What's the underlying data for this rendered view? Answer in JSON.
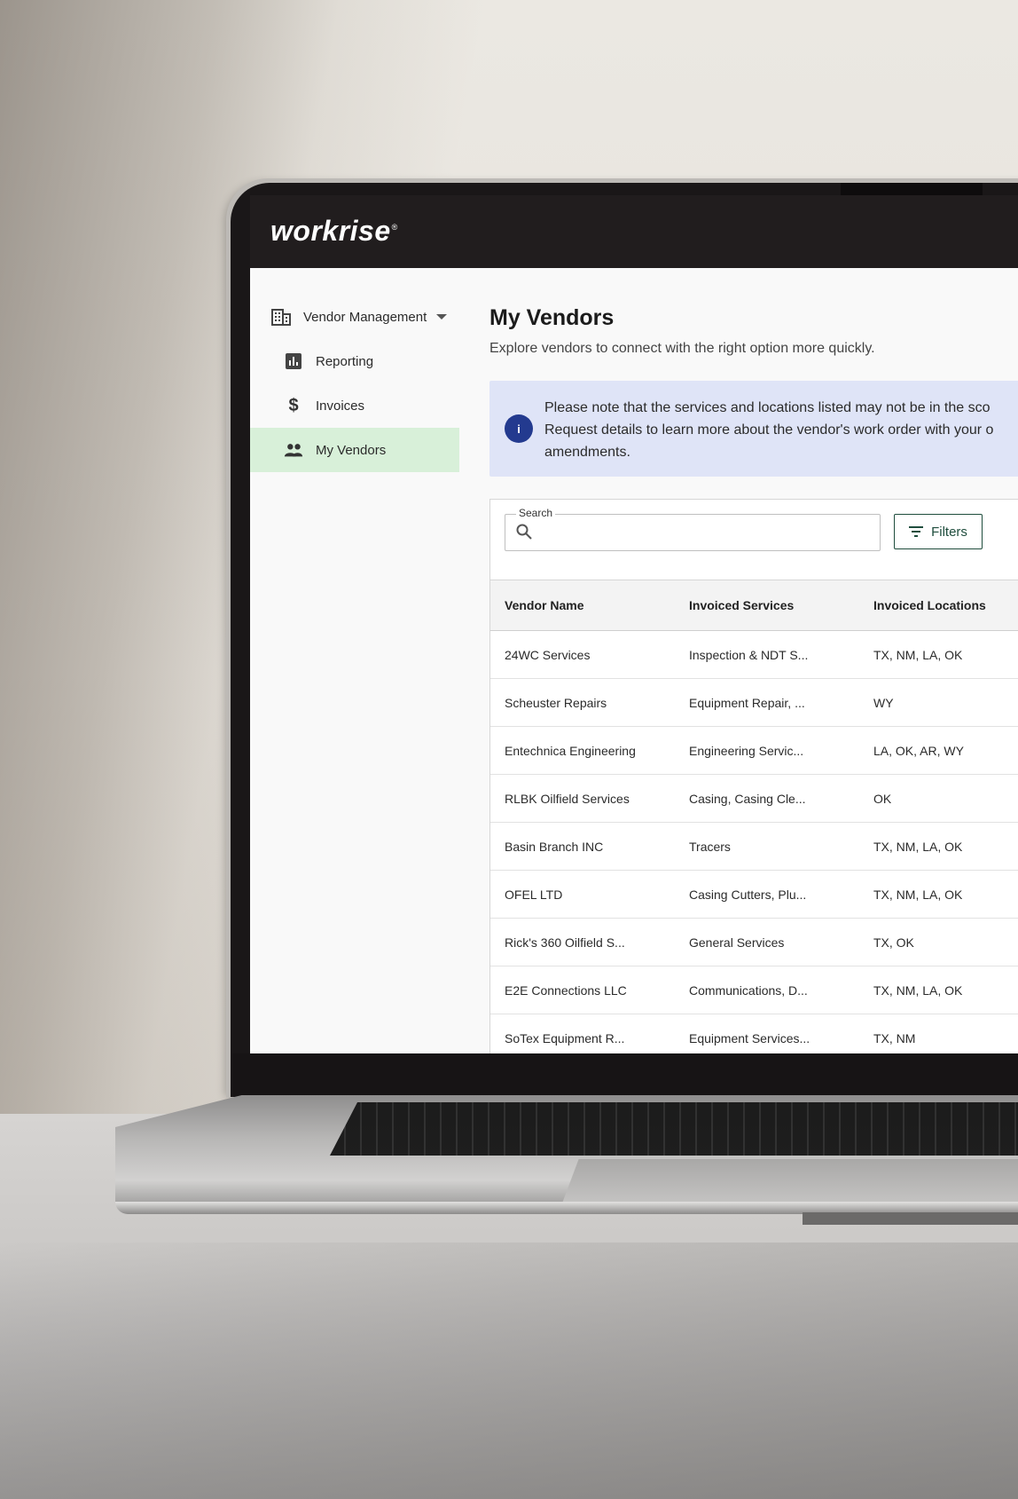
{
  "app": {
    "logo_text": "workrise",
    "logo_mark": "®"
  },
  "sidebar": {
    "items": [
      {
        "label": "Vendor Management",
        "icon": "building-icon",
        "expanded": true
      },
      {
        "label": "Reporting",
        "icon": "bar-chart-icon"
      },
      {
        "label": "Invoices",
        "icon": "dollar-icon"
      },
      {
        "label": "My Vendors",
        "icon": "people-icon",
        "active": true
      }
    ]
  },
  "main": {
    "title": "My Vendors",
    "subtitle": "Explore vendors to connect with the right option more quickly.",
    "notice": {
      "icon": "info-icon",
      "line1": "Please note that the services and locations listed may not be in the sco",
      "line2": "Request details to learn more about the vendor's work order with your o",
      "line3": "amendments."
    },
    "search": {
      "label": "Search",
      "value": "",
      "placeholder": ""
    },
    "filters_label": "Filters",
    "table": {
      "columns": [
        "Vendor Name",
        "Invoiced Services",
        "Invoiced Locations"
      ],
      "rows": [
        [
          "24WC Services",
          "Inspection & NDT S...",
          "TX, NM, LA, OK"
        ],
        [
          "Scheuster Repairs",
          "Equipment Repair, ...",
          "WY"
        ],
        [
          "Entechnica Engineering",
          "Engineering Servic...",
          "LA, OK, AR, WY"
        ],
        [
          "RLBK Oilfield Services",
          "Casing, Casing Cle...",
          "OK"
        ],
        [
          "Basin Branch INC",
          "Tracers",
          "TX, NM, LA, OK"
        ],
        [
          "OFEL LTD",
          "Casing Cutters, Plu...",
          "TX, NM, LA, OK"
        ],
        [
          "Rick's 360 Oilfield S...",
          "General Services",
          "TX, OK"
        ],
        [
          "E2E Connections LLC",
          "Communications, D...",
          "TX, NM, LA, OK"
        ],
        [
          "SoTex Equipment R...",
          "Equipment Services...",
          "TX, NM"
        ]
      ]
    }
  },
  "colors": {
    "header_bg": "#211d1e",
    "active_nav_bg": "#d8f0d9",
    "notice_bg": "#dfe4f7",
    "info_icon_bg": "#233a8f",
    "filters_accent": "#1f4d3d"
  }
}
